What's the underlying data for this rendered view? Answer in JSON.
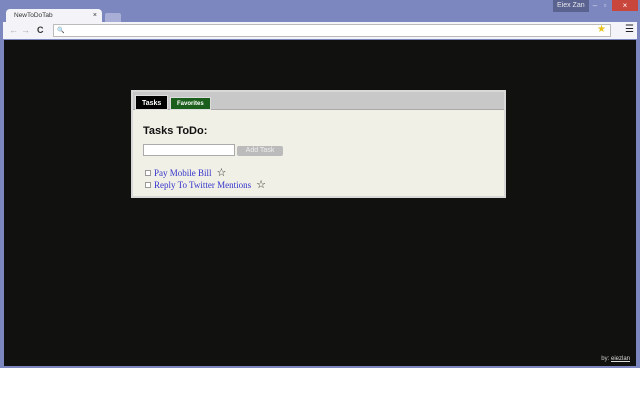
{
  "browser": {
    "tab_title": "NewToDoTab",
    "tab_close": "×",
    "user": "Eiex Zan",
    "minimize": "–",
    "maximize": "▫",
    "close": "×",
    "back": "←",
    "forward": "→",
    "reload": "C",
    "search_icon": "🔍",
    "bookmark_star": "★",
    "menu": "☰"
  },
  "panel": {
    "tabs": [
      {
        "label": "Tasks"
      },
      {
        "label": "Favorites"
      }
    ],
    "heading": "Tasks ToDo:",
    "input_value": "",
    "add_label": "Add Task",
    "tasks": [
      {
        "label": "Pay Mobile Bill",
        "star": "☆"
      },
      {
        "label": "Reply To Twitter Mentions",
        "star": "☆"
      }
    ]
  },
  "footer": {
    "by": "by:",
    "author": "eiezlan"
  }
}
